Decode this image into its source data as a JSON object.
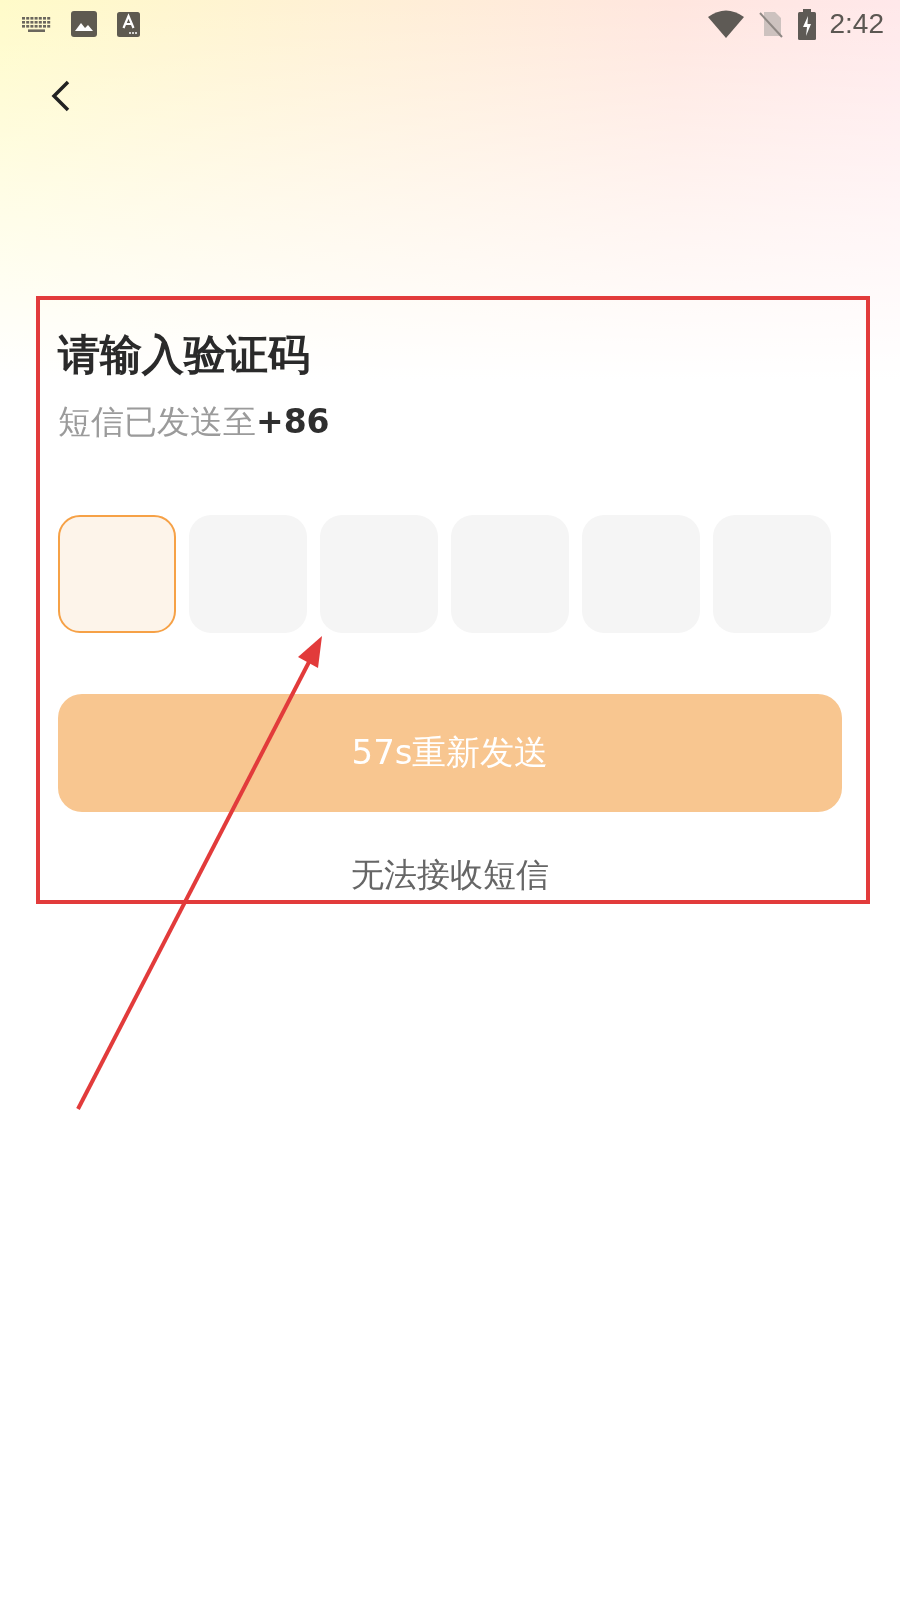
{
  "status_bar": {
    "time": "2:42"
  },
  "title": "请输入验证码",
  "subtitle": "短信已发送至**+86**",
  "code_boxes": [
    {
      "focused": true
    },
    {
      "focused": false
    },
    {
      "focused": false
    },
    {
      "focused": false
    },
    {
      "focused": false
    },
    {
      "focused": false
    }
  ],
  "resend_button": {
    "label": "57s重新发送",
    "disabled": true
  },
  "help_link": "无法接收短信"
}
